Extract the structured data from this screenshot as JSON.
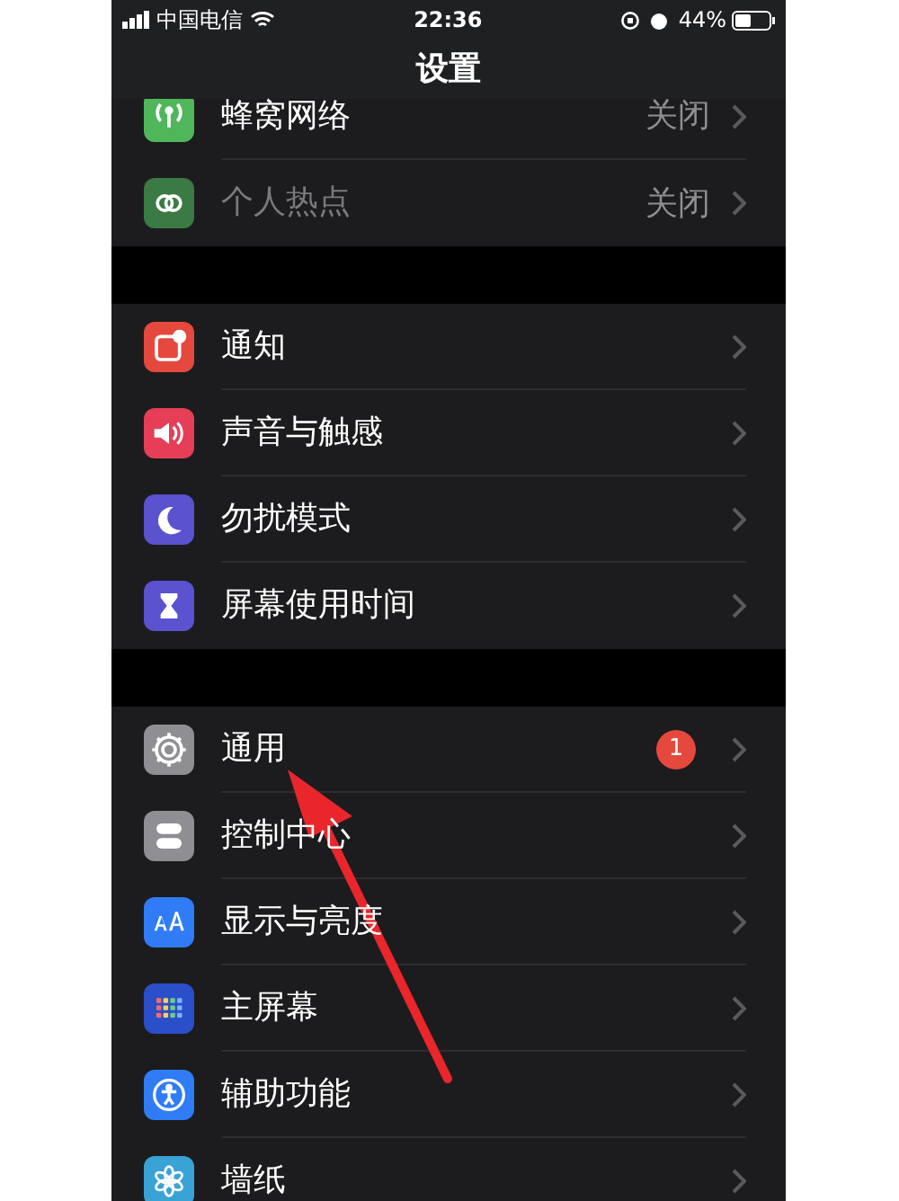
{
  "status_bar": {
    "carrier": "中国电信",
    "time": "22:36",
    "battery": "44%"
  },
  "title": "设置",
  "sections": [
    {
      "rows": [
        {
          "label": "蜂窝网络",
          "value": "关闭",
          "color": "#4fb75a",
          "disabled": false
        },
        {
          "label": "个人热点",
          "value": "关闭",
          "color": "#3a7a44",
          "disabled": true
        }
      ]
    },
    {
      "rows": [
        {
          "label": "通知",
          "color": "#e5483d",
          "disabled": false
        },
        {
          "label": "声音与触感",
          "color": "#e63e57",
          "disabled": false
        },
        {
          "label": "勿扰模式",
          "color": "#5a52cf",
          "disabled": false
        },
        {
          "label": "屏幕使用时间",
          "color": "#5a52cf",
          "disabled": false
        }
      ]
    },
    {
      "rows": [
        {
          "label": "通用",
          "badge": "1",
          "color": "#8e8e93",
          "disabled": false
        },
        {
          "label": "控制中心",
          "color": "#8e8e93",
          "disabled": false
        },
        {
          "label": "显示与亮度",
          "color": "#2f7cf6",
          "disabled": false
        },
        {
          "label": "主屏幕",
          "color": "#2b4fc9",
          "disabled": false
        },
        {
          "label": "辅助功能",
          "color": "#2f7cf6",
          "disabled": false
        },
        {
          "label": "墙纸",
          "color": "#3aa3d6",
          "disabled": false
        }
      ]
    }
  ]
}
